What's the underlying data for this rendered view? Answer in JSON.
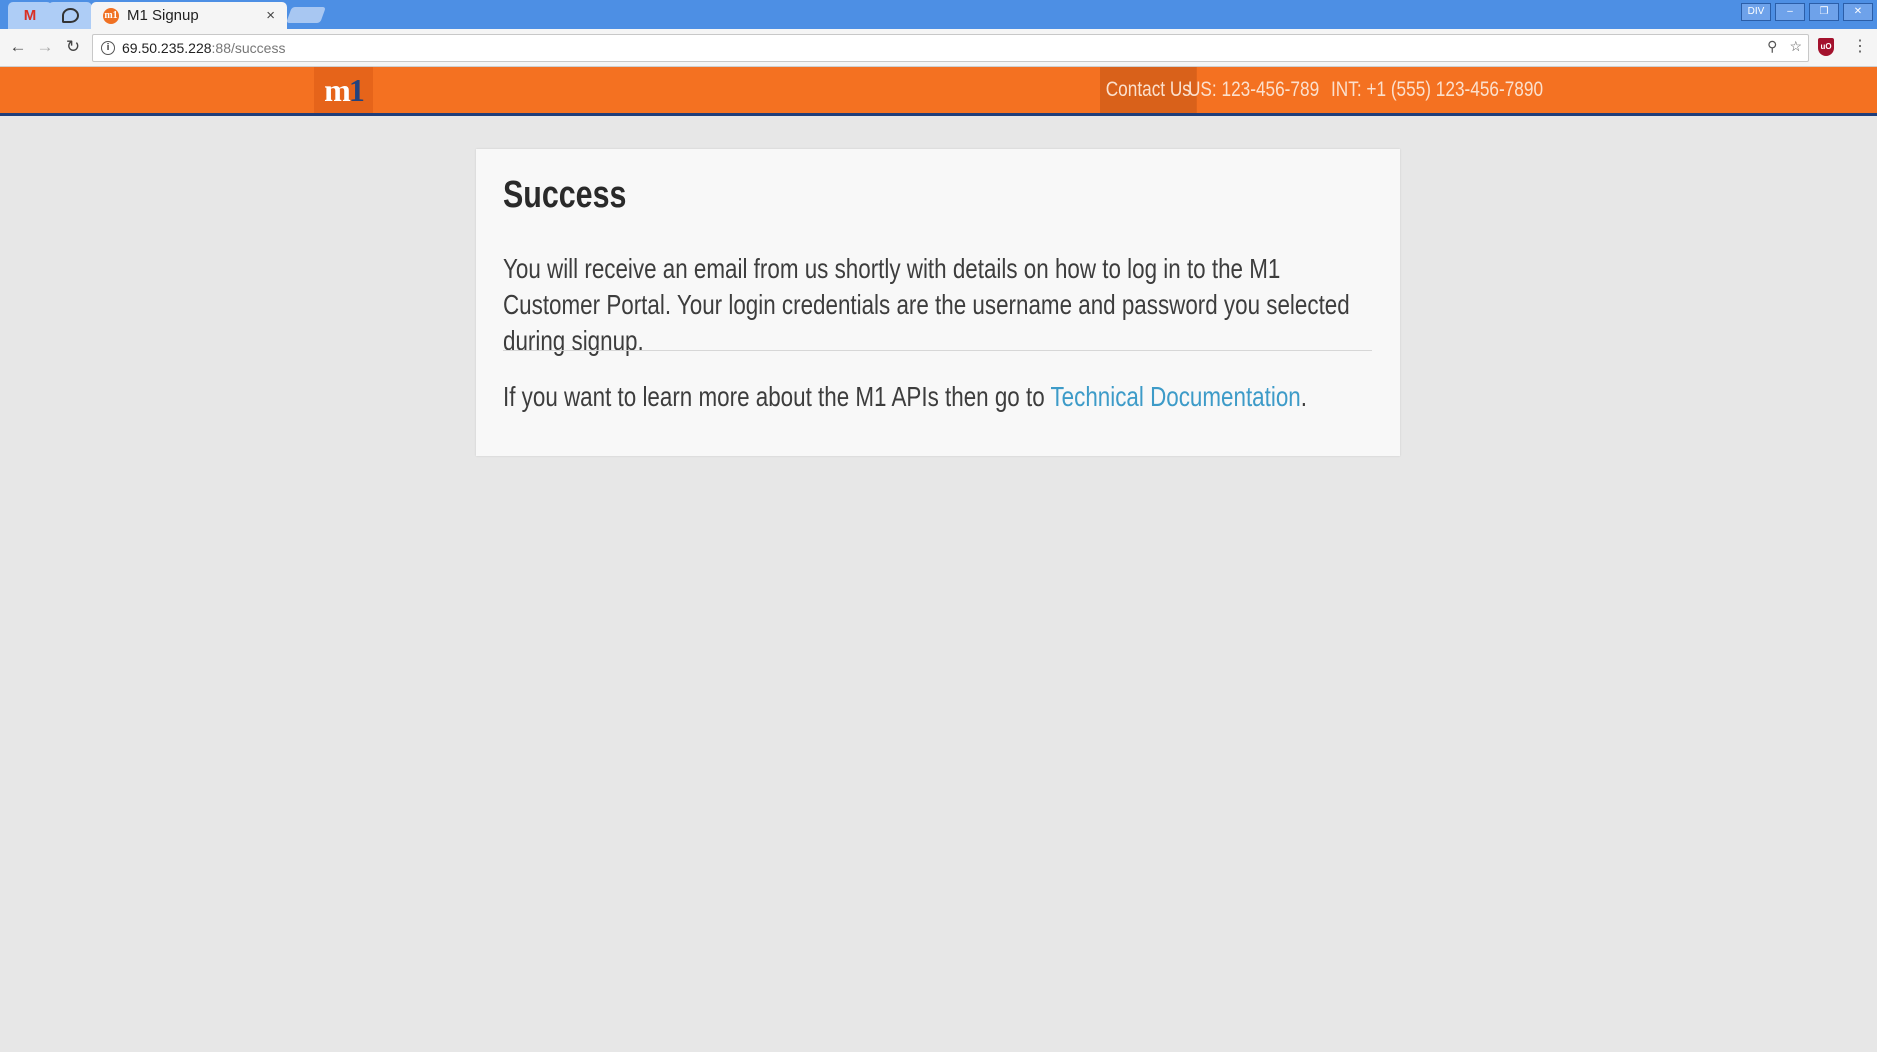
{
  "browser": {
    "tabs": [
      {
        "label": "M",
        "kind": "gmail"
      },
      {
        "label": "chat",
        "kind": "hangouts"
      }
    ],
    "active_tab": {
      "title": "M1 Signup",
      "close": "×"
    },
    "window_controls": [
      "DIV",
      "–",
      "❐",
      "✕"
    ],
    "nav": {
      "back": "←",
      "forward": "→",
      "reload": "↻"
    },
    "url": {
      "host": "69.50.235.228",
      "rest": ":88/success"
    }
  },
  "header": {
    "logo": "m1",
    "contact_label": "Contact Us",
    "phone_us": "US: 123-456-789",
    "phone_int": "INT: +1 (555) 123-456-7890"
  },
  "card": {
    "title": "Success",
    "body": "You will receive an email from us shortly with details on how to log in to the M1 Customer Portal. Your login credentials are the username and password you selected during signup.",
    "footer_prefix": "If you want to learn more about the M1 APIs then go to ",
    "footer_link": "Technical Documentation",
    "footer_suffix": "."
  },
  "colors": {
    "brand_orange": "#f47121",
    "brand_navy": "#1f3e7a",
    "link": "#3d9bc8",
    "page_bg": "#e7e7e7"
  }
}
